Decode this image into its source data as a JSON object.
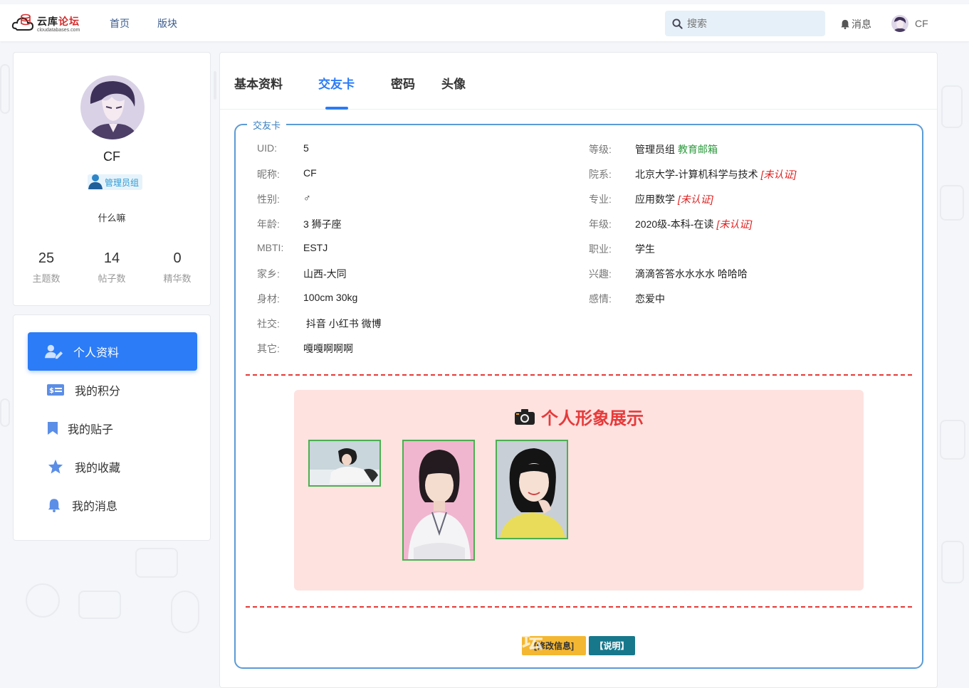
{
  "header": {
    "logo_cn_a": "云库",
    "logo_cn_b": "论坛",
    "logo_en": "cloudatabases.com",
    "nav": [
      "首页",
      "版块"
    ],
    "search_placeholder": "搜索",
    "messages_label": "消息",
    "username": "CF"
  },
  "profile": {
    "name": "CF",
    "group": "管理员组",
    "signature": "什么嘛",
    "stats": [
      {
        "value": "25",
        "label": "主题数"
      },
      {
        "value": "14",
        "label": "帖子数"
      },
      {
        "value": "0",
        "label": "精华数"
      }
    ]
  },
  "menu": [
    {
      "label": "个人资料",
      "icon": "user-edit-icon"
    },
    {
      "label": "我的积分",
      "icon": "money-icon"
    },
    {
      "label": "我的贴子",
      "icon": "bookmark-icon"
    },
    {
      "label": "我的收藏",
      "icon": "star-icon"
    },
    {
      "label": "我的消息",
      "icon": "bell-icon"
    }
  ],
  "tabs": [
    "基本资料",
    "交友卡",
    "密码",
    "头像"
  ],
  "active_tab": "交友卡",
  "card": {
    "legend": "交友卡",
    "left": [
      {
        "key": "UID:",
        "value": "5"
      },
      {
        "key": "昵称:",
        "value": "CF"
      },
      {
        "key": "性别:",
        "value": "♂"
      },
      {
        "key": "年龄:",
        "value": "3 狮子座"
      },
      {
        "key": "MBTI:",
        "value": "ESTJ"
      },
      {
        "key": "家乡:",
        "value": "山西-大同"
      },
      {
        "key": "身材:",
        "value": "100cm 30kg"
      },
      {
        "key": "社交:",
        "value": " 抖音 小红书 微博"
      },
      {
        "key": "其它:",
        "value": "嘎嘎啊啊啊"
      }
    ],
    "right": [
      {
        "key": "等级:",
        "value": "管理员组",
        "extra": "教育邮箱"
      },
      {
        "key": "院系:",
        "value": "北京大学-计算机科学与技术",
        "flag": "[未认证]"
      },
      {
        "key": "专业:",
        "value": "应用数学",
        "flag": "[未认证]"
      },
      {
        "key": "年级:",
        "value": "2020级-本科-在读",
        "flag": "[未认证]"
      },
      {
        "key": "职业:",
        "value": "学生"
      },
      {
        "key": "兴趣:",
        "value": "滴滴答答水水水水 哈哈哈"
      },
      {
        "key": "感情:",
        "value": "恋爱中"
      }
    ],
    "showcase_title": "个人形象展示",
    "edit_button": "[修改信息]",
    "help_button": "【说明】"
  },
  "watermark": "云库论坛",
  "colors": {
    "accent": "#2b7cf6",
    "danger": "#e53935",
    "showcase_bg": "#fde2e0",
    "edit_btn": "#f4b731",
    "help_btn": "#17788c"
  }
}
